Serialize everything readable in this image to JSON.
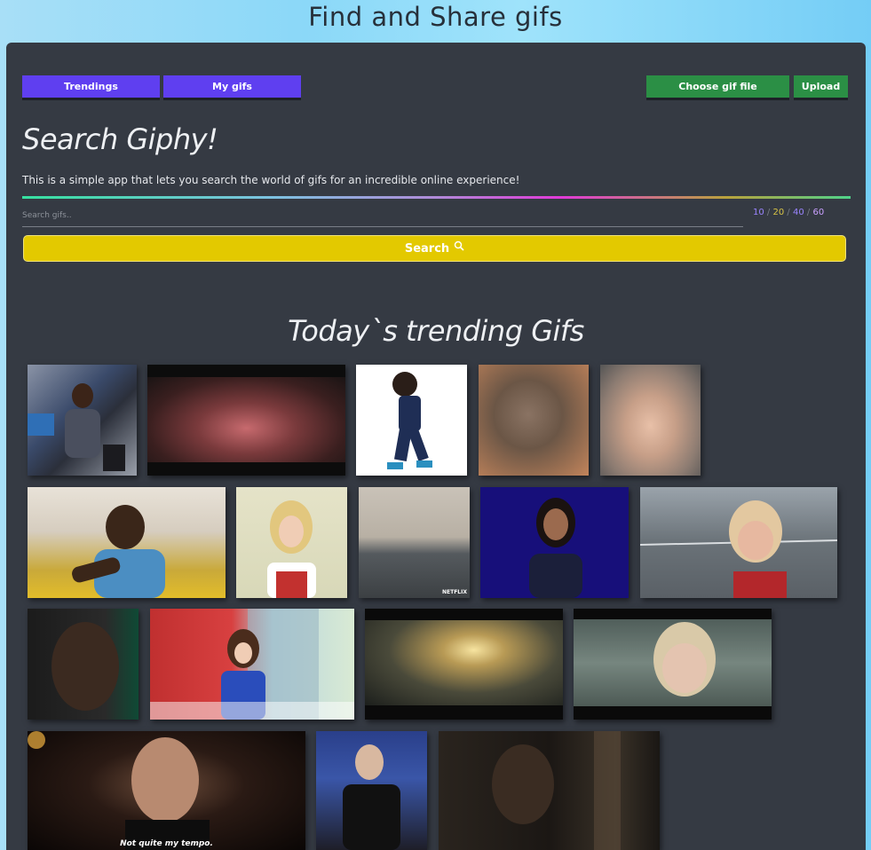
{
  "header": {
    "title": "Find and Share gifs"
  },
  "nav": {
    "trendings_label": "Trendings",
    "mygifs_label": "My gifs",
    "choose_file_label": "Choose gif file",
    "upload_label": "Upload"
  },
  "search": {
    "heading": "Search Giphy!",
    "subtitle": "This is a simple app that lets you search the world of gifs for an incredible online experience!",
    "placeholder": "Search gifs..",
    "limits": [
      "10",
      "20",
      "40",
      "60"
    ],
    "selected_limit": "20",
    "button_label": "Search",
    "button_icon": "search-icon"
  },
  "trending": {
    "heading": "Today`s trending Gifs",
    "gifs": [
      {
        "name": "gif-woman-on-stage",
        "caption": ""
      },
      {
        "name": "gif-person-in-bed",
        "caption": ""
      },
      {
        "name": "gif-football-player-dance",
        "caption": ""
      },
      {
        "name": "gif-cat",
        "caption": ""
      },
      {
        "name": "gif-little-girl",
        "caption": ""
      },
      {
        "name": "gif-man-shrugging",
        "caption": ""
      },
      {
        "name": "gif-woman-gasp",
        "caption": ""
      },
      {
        "name": "gif-cheerleading-gym",
        "caption": "",
        "tag": "NETFLIX"
      },
      {
        "name": "gif-woman-purple-bg",
        "caption": ""
      },
      {
        "name": "gif-woman-smiling-ring",
        "caption": ""
      },
      {
        "name": "gif-man-green-bg",
        "caption": ""
      },
      {
        "name": "gif-woman-podium",
        "caption": ""
      },
      {
        "name": "gif-city-street-light",
        "caption": ""
      },
      {
        "name": "gif-woman-makeup",
        "caption": ""
      },
      {
        "name": "gif-conductor",
        "caption": "Not quite my tempo."
      },
      {
        "name": "gif-skater-clapping",
        "caption": ""
      },
      {
        "name": "gif-dark-scene",
        "caption": ""
      }
    ]
  },
  "colors": {
    "panel": "#353a43",
    "purple_button": "#5f3ff0",
    "green_button": "#2b8f45",
    "search_button": "#e3c900"
  }
}
